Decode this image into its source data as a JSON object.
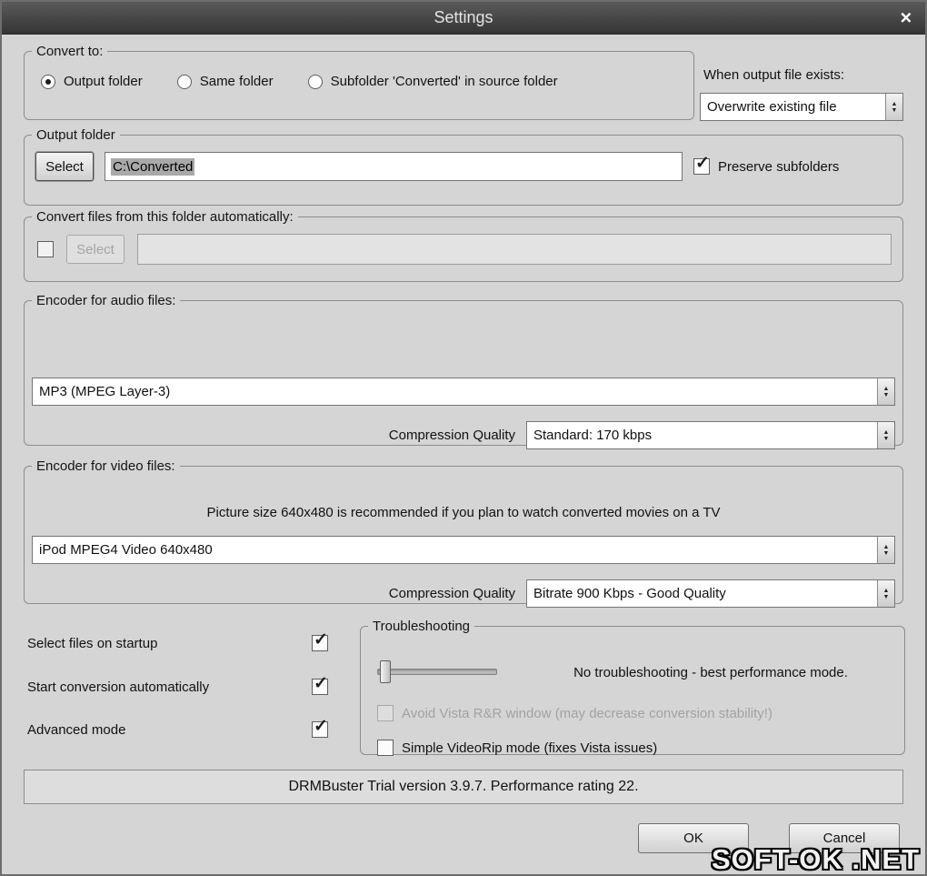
{
  "window": {
    "title": "Settings",
    "close_glyph": "✕"
  },
  "convert_to": {
    "legend": "Convert to:",
    "options": [
      {
        "label": "Output folder",
        "selected": true
      },
      {
        "label": "Same folder",
        "selected": false
      },
      {
        "label": "Subfolder 'Converted' in source folder",
        "selected": false
      }
    ]
  },
  "output_exists": {
    "label": "When output file exists:",
    "value": "Overwrite existing file"
  },
  "output_folder": {
    "legend": "Output folder",
    "select_label": "Select",
    "path": "C:\\Converted",
    "preserve_label": "Preserve subfolders",
    "preserve_checked": true
  },
  "auto_convert": {
    "legend": "Convert files from this folder automatically:",
    "select_label": "Select",
    "path": "",
    "enabled": false,
    "checked": false
  },
  "audio_encoder": {
    "legend": "Encoder for audio files:",
    "encoder": "MP3 (MPEG Layer-3)",
    "quality_label": "Compression Quality",
    "quality": "Standard: 170 kbps"
  },
  "video_encoder": {
    "legend": "Encoder for video files:",
    "note": "Picture size 640x480 is recommended if you plan to watch converted movies on a TV",
    "encoder": "iPod MPEG4 Video 640x480",
    "quality_label": "Compression Quality",
    "quality": "Bitrate 900 Kbps - Good Quality"
  },
  "startup_options": [
    {
      "label": "Select files on startup",
      "checked": true
    },
    {
      "label": "Start conversion automatically",
      "checked": true
    },
    {
      "label": "Advanced mode",
      "checked": true
    }
  ],
  "troubleshooting": {
    "legend": "Troubleshooting",
    "status": "No troubleshooting - best performance mode.",
    "slider_position": 0,
    "options": [
      {
        "label": "Avoid Vista R&R window (may decrease conversion stability!)",
        "checked": false,
        "enabled": false
      },
      {
        "label": "Simple VideoRip mode (fixes Vista issues)",
        "checked": false,
        "enabled": true
      }
    ]
  },
  "status_bar": {
    "text": "DRMBuster Trial version 3.9.7. Performance rating 22."
  },
  "footer": {
    "ok_label": "OK",
    "cancel_label": "Cancel"
  },
  "watermark": {
    "text": "SOFT-OK .NET"
  },
  "icons": {
    "spinner_up": "▲",
    "spinner_down": "▼",
    "check": "✓"
  }
}
